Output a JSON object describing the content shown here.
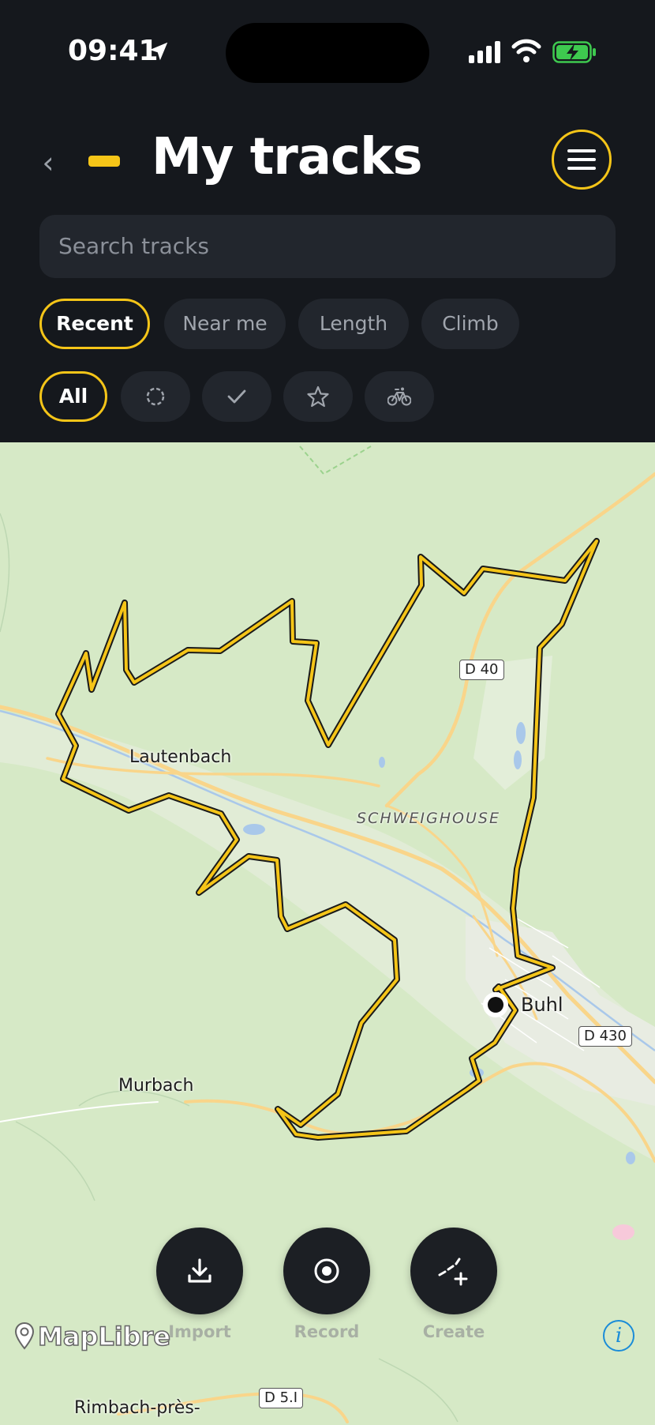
{
  "status_bar": {
    "time": "09:41"
  },
  "header": {
    "title": "My tracks"
  },
  "search": {
    "placeholder": "Search tracks"
  },
  "sort_chips": [
    {
      "label": "Recent",
      "active": true
    },
    {
      "label": "Near me",
      "active": false
    },
    {
      "label": "Length",
      "active": false
    },
    {
      "label": "Climb",
      "active": false
    }
  ],
  "filter_chips": [
    {
      "label": "All",
      "active": true
    },
    {
      "icon": "dashed-circle-icon"
    },
    {
      "icon": "checkmark-icon"
    },
    {
      "icon": "star-icon"
    },
    {
      "icon": "bicycle-icon"
    }
  ],
  "map": {
    "places": [
      "Lautenbach",
      "SCHWEIGHOUSE",
      "Buhl",
      "Murbach",
      "Rimbach-près-"
    ],
    "roads": [
      "D 40",
      "D 430",
      "D 5.I"
    ],
    "attribution": "MapLibre"
  },
  "actions": [
    {
      "label": "Import",
      "icon": "download-icon"
    },
    {
      "label": "Record",
      "icon": "record-icon"
    },
    {
      "label": "Create",
      "icon": "create-route-icon"
    }
  ],
  "colors": {
    "accent": "#f5c518",
    "header_bg": "#15181d",
    "chip_bg": "#22262d",
    "map_bg": "#d6e9c6",
    "info": "#1a8cd8"
  }
}
